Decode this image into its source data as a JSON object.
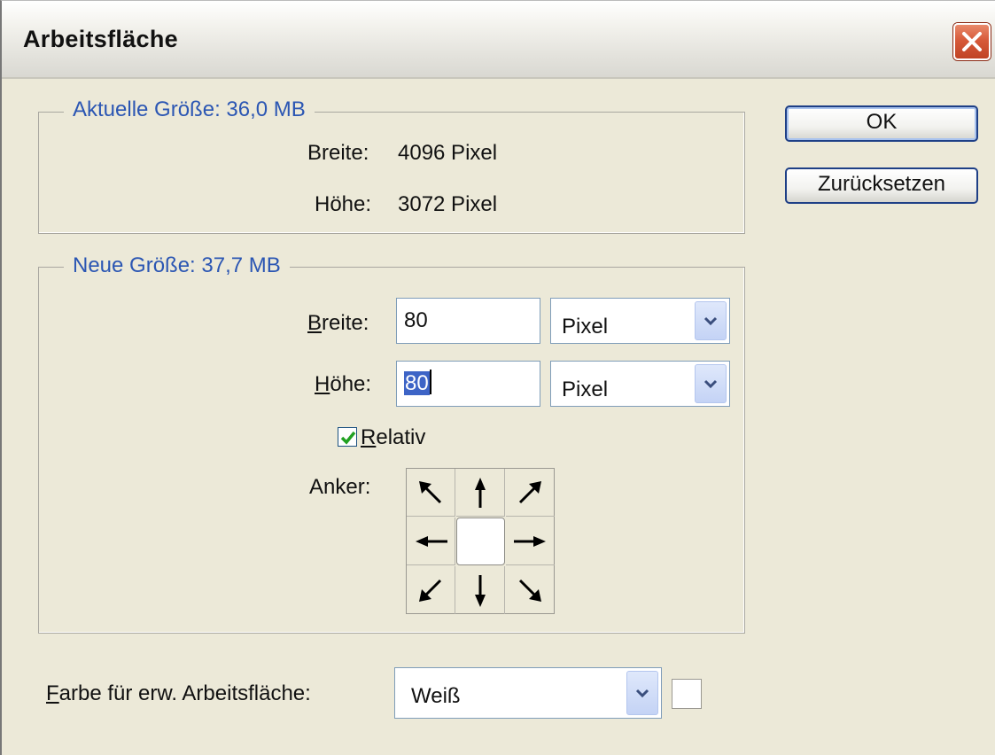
{
  "dialog": {
    "title": "Arbeitsfläche"
  },
  "buttons": {
    "ok": "OK",
    "reset": "Zurücksetzen"
  },
  "current_size": {
    "legend": "Aktuelle Größe: 36,0 MB",
    "width_label": "Breite:",
    "width_value": "4096 Pixel",
    "height_label": "Höhe:",
    "height_value": "3072 Pixel"
  },
  "new_size": {
    "legend": "Neue Größe: 37,7 MB",
    "width_label_key": "B",
    "width_label_rest": "reite:",
    "width_value": "80",
    "width_unit": "Pixel",
    "height_label_key": "H",
    "height_label_rest": "öhe:",
    "height_value": "80",
    "height_unit": "Pixel",
    "relative_key": "R",
    "relative_rest": "elativ",
    "relative_checked": true,
    "anchor_label": "Anker:"
  },
  "extension_color": {
    "label_key": "F",
    "label_rest": "arbe für erw. Arbeitsfläche:",
    "value": "Weiß",
    "swatch_color": "#ffffff"
  },
  "icons": {
    "close": "close-icon",
    "dropdown": "chevron-down-icon",
    "anchor": [
      "arrow-up-left-icon",
      "arrow-up-icon",
      "arrow-up-right-icon",
      "arrow-left-icon",
      "anchor-center",
      "arrow-right-icon",
      "arrow-down-left-icon",
      "arrow-down-icon",
      "arrow-down-right-icon"
    ]
  }
}
